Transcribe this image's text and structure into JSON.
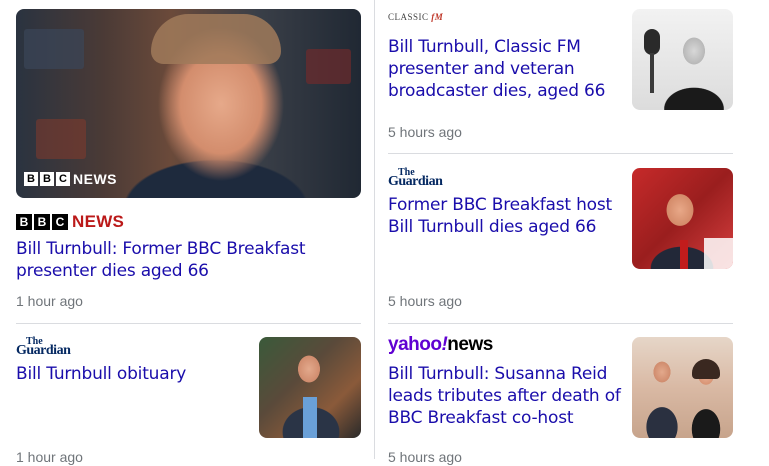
{
  "articles": [
    {
      "source": "BBC NEWS",
      "image_badge": "NEWS",
      "headline": "Bill Turnbull: Former BBC Breakfast presenter dies aged 66",
      "time": "1 hour ago"
    },
    {
      "source": "CLASSIC fM",
      "headline": "Bill Turnbull, Classic FM presenter and veteran broadcaster dies, aged 66",
      "time": "5 hours ago"
    },
    {
      "source": "The Guardian",
      "headline": "Former BBC Breakfast host Bill Turnbull dies aged 66",
      "time": "5 hours ago"
    },
    {
      "source": "The Guardian",
      "headline": "Bill Turnbull obituary",
      "time": "1 hour ago"
    },
    {
      "source": "yahoo!news",
      "headline": "Bill Turnbull: Susanna Reid leads tributes after death of BBC Breakfast co-host",
      "time": "5 hours ago"
    }
  ],
  "logos": {
    "bbc_letters": [
      "B",
      "B",
      "C"
    ],
    "bbc_news": "NEWS",
    "guardian_the": "The",
    "guardian_name": "Guardian",
    "classic_text": "CLASSIC",
    "classic_fm": "fM",
    "yahoo_main": "yahoo",
    "yahoo_bang": "!",
    "yahoo_news": "news"
  },
  "colors": {
    "headline": "#1a0dab",
    "time": "#70757a",
    "bbc_red": "#bb1919",
    "guardian_blue": "#052962",
    "yahoo_purple": "#6001d2"
  }
}
